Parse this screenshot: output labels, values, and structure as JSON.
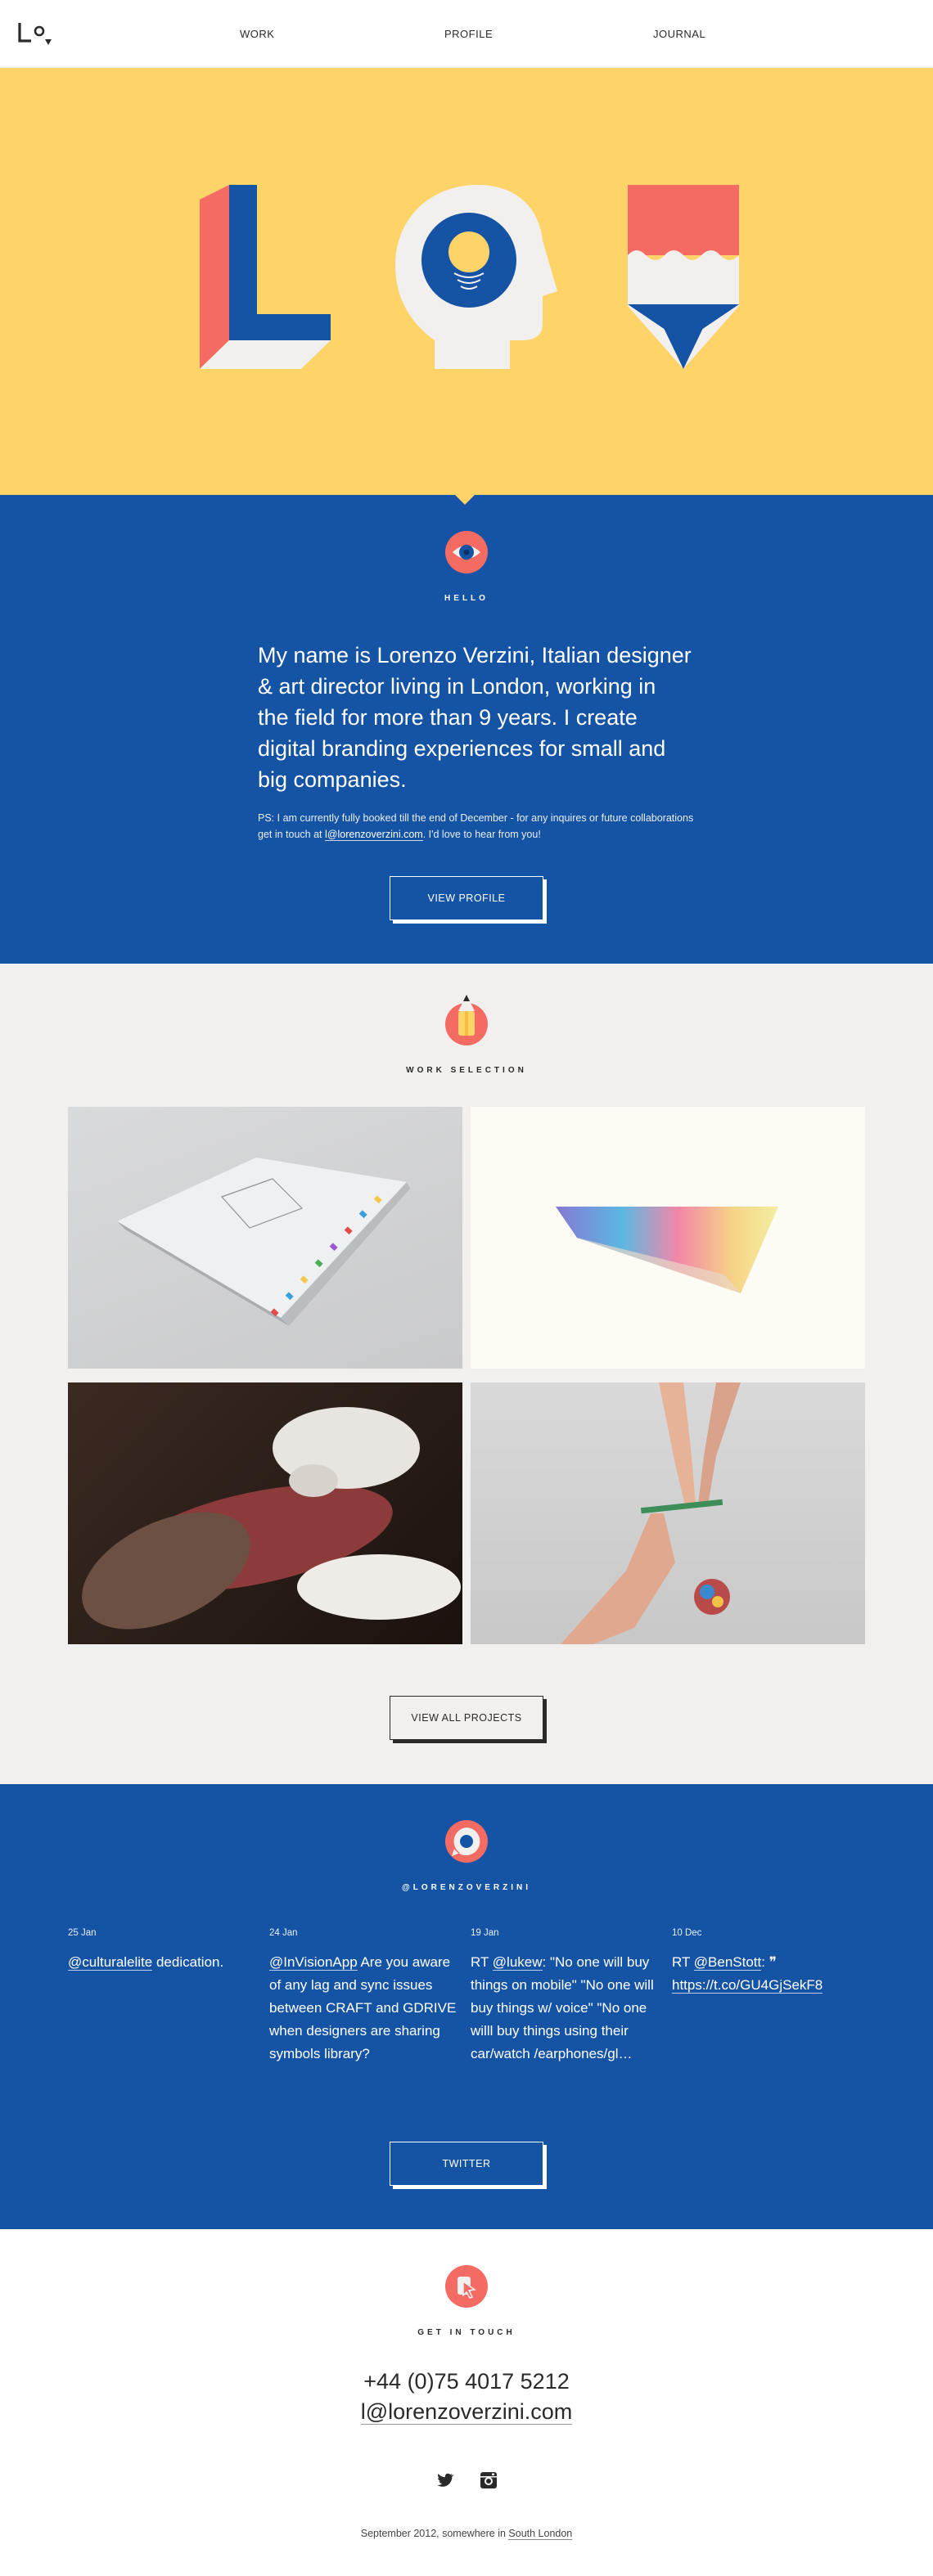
{
  "nav": {
    "logo_text": "Lo",
    "links": [
      "WORK",
      "PROFILE",
      "JOURNAL"
    ]
  },
  "colors": {
    "yellow": "#fed468",
    "blue": "#1553a4",
    "coral": "#f46b64",
    "light_gray": "#f1f0ee"
  },
  "hero": {
    "icons": [
      "letter-l-icon",
      "head-profile-icon",
      "pencil-icon"
    ]
  },
  "hello": {
    "icon": "eye-icon",
    "label": "HELLO",
    "intro": "My name is Lorenzo Verzini, Italian designer & art director living in London, working in the field for more than 9 years. I create digital branding experiences for small and big companies.",
    "ps_before": "PS: I am currently fully booked till the end of December - for any inquires or future collaborations get in touch at ",
    "ps_email": "l@lorenzoverzini.com",
    "ps_after": ". I'd love to hear from you!",
    "button": "VIEW PROFILE"
  },
  "work": {
    "icon": "pencil-icon",
    "label": "WORK SELECTION",
    "projects": [
      "book-project-image",
      "prism-project-image",
      "tattoo-project-image",
      "hands-project-image"
    ],
    "button": "VIEW ALL PROJECTS"
  },
  "twitter": {
    "icon": "speech-bubble-icon",
    "label": "@LORENZOVERZINI",
    "tweets": [
      {
        "date": "25 Jan",
        "handle": "@culturalelite",
        "text": " dedication."
      },
      {
        "date": "24 Jan",
        "handle": "@InVisionApp",
        "text": " Are you aware of any lag and sync issues between CRAFT and GDRIVE when designers are sharing symbols library?"
      },
      {
        "date": "19 Jan",
        "prefix": "RT ",
        "handle": "@lukew",
        "text": ": \"No one will buy things on mobile\" \"No one will buy things w/ voice\" \"No one willl buy things using their car/watch /earphones/gl…"
      },
      {
        "date": "10 Dec",
        "prefix": "RT ",
        "handle": "@BenStott",
        "text": ": ❞ ",
        "link": "https://t.co/GU4GjSekF8"
      }
    ],
    "button": "TWITTER"
  },
  "contact": {
    "icon": "cursor-icon",
    "label": "GET IN TOUCH",
    "phone": "+44 (0)75 4017 5212",
    "email": "l@lorenzoverzini.com",
    "footer_before": "September 2012, somewhere in ",
    "footer_link": "South London"
  }
}
